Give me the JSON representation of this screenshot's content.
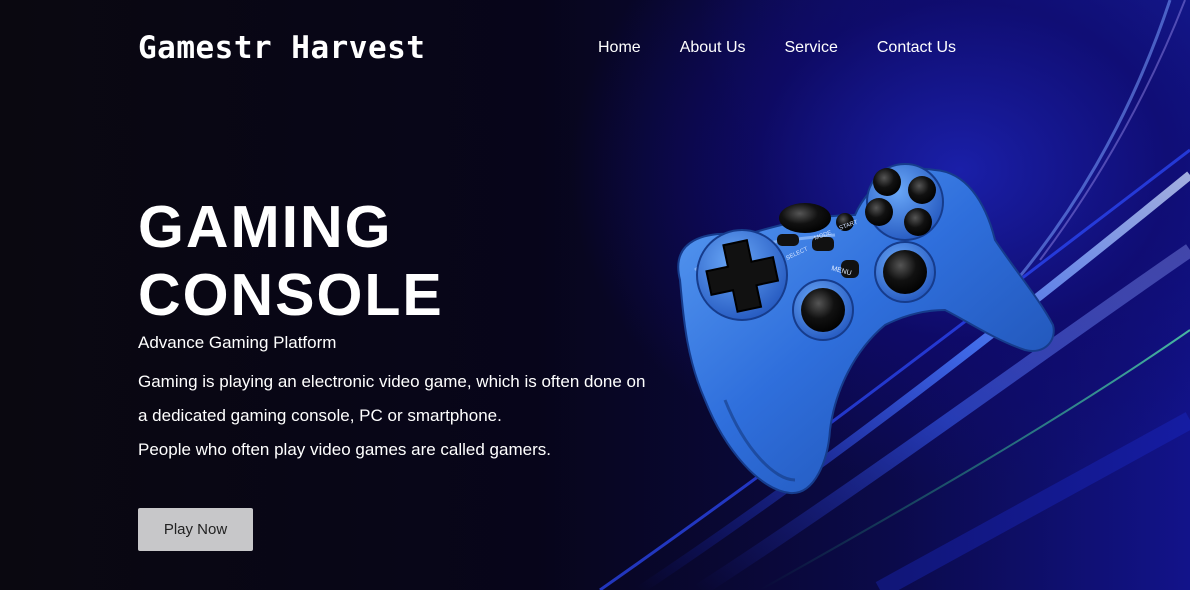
{
  "brand": {
    "logo": "Gamestr Harvest"
  },
  "nav": {
    "items": [
      {
        "label": "Home"
      },
      {
        "label": "About Us"
      },
      {
        "label": "Service"
      },
      {
        "label": "Contact Us"
      }
    ]
  },
  "hero": {
    "title_line1": "GAMING",
    "title_line2": "CONSOLE",
    "subtitle": "Advance Gaming Platform",
    "desc_line1": "Gaming is playing an electronic video game, which is often done on",
    "desc_line2": "a dedicated gaming console, PC or smartphone.",
    "desc_line3": "People who often play video games are called gamers.",
    "cta_label": "Play Now"
  },
  "controller": {
    "select_label": "SELECT",
    "mode_label": "MODE",
    "start_label": "START",
    "menu_label": "MENU"
  },
  "colors": {
    "background": "#05030f",
    "accent_blue": "#2f6fdc",
    "button_bg": "#c7c7c9",
    "text": "#ffffff"
  }
}
